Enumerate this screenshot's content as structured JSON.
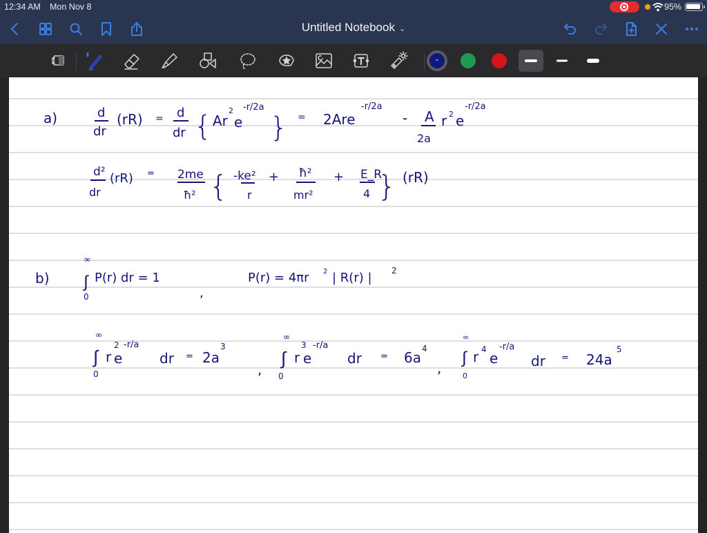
{
  "status_bar": {
    "time": "12:34 AM",
    "date": "Mon Nov 8",
    "battery_percent_label": "95%",
    "battery_level": 0.95,
    "screen_recording": true
  },
  "nav_bar": {
    "title": "Untitled Notebook",
    "left_buttons": [
      "back-icon",
      "grid-icon",
      "search-icon",
      "bookmark-icon",
      "share-icon"
    ],
    "right_buttons": [
      "undo-icon",
      "redo-icon",
      "add-page-icon",
      "close-icon",
      "more-icon"
    ]
  },
  "toolbar": {
    "tools": [
      "read-mode-icon",
      "pen-icon",
      "eraser-icon",
      "highlighter-icon",
      "shapes-icon",
      "lasso-icon",
      "sticker-icon",
      "image-icon",
      "text-icon",
      "laser-pointer-icon"
    ],
    "active_tool": "pen",
    "colors": [
      {
        "name": "navy",
        "hex": "#0e1a7a",
        "selected": true
      },
      {
        "name": "green",
        "hex": "#1f9a52",
        "selected": false
      },
      {
        "name": "red",
        "hex": "#d6121a",
        "selected": false
      }
    ],
    "stroke_sizes": [
      "fine",
      "medium",
      "thick"
    ],
    "selected_size": "fine"
  },
  "notes": {
    "ink_color": "#14147a",
    "part_a": {
      "label": "a)",
      "line1": {
        "lhs_num": "d",
        "lhs_den": "dr",
        "lhs_arg": "(rR)",
        "eq1": "=",
        "mid_num": "d",
        "mid_den": "dr",
        "mid_body": "Ar",
        "mid_sq": "2",
        "mid_e": "e",
        "mid_exp": "-r/2a",
        "eq2": "=",
        "t1": "2Are",
        "t1_exp": "-r/2a",
        "minus": "-",
        "t2_num": "A",
        "t2_den": "2a",
        "t2_body": "r",
        "t2_sq": "2",
        "t2_e": "e",
        "t2_exp": "-r/2a"
      },
      "line2": {
        "lhs_num": "d²",
        "lhs_den": "dr",
        "lhs_arg": "(rR)",
        "eq": "=",
        "c_num": "2me",
        "c_den": "ħ²",
        "f1_num": "-ke²",
        "f1_den": "r",
        "plus1": "+",
        "f2_num": "ħ²",
        "f2_den": "mr²",
        "plus2": "+",
        "f3_num": "E_R",
        "f3_den": "4",
        "tail": "(rR)"
      }
    },
    "part_b": {
      "label": "b)",
      "line1": {
        "int_upper": "∞",
        "int_lower": "0",
        "integrand": "P(r) dr = 1",
        "comma": ",",
        "p_def": "P(r) = 4πr",
        "p_sq": "2",
        "p_rest": "| R(r) |",
        "p_rest_sq": "2"
      },
      "line2": {
        "i1": {
          "upper": "∞",
          "lower": "0",
          "r": "r",
          "pow": "2",
          "e": "e",
          "exp": "-r/a",
          "dr": "dr",
          "eq": "=",
          "result": "2a",
          "result_pow": "3"
        },
        "i2": {
          "upper": "∞",
          "lower": "0",
          "r": "r",
          "pow": "3",
          "e": "e",
          "exp": "-r/a",
          "dr": "dr",
          "eq": "=",
          "result": "6a",
          "result_pow": "4"
        },
        "i3": {
          "upper": "∞",
          "lower": "0",
          "r": "r",
          "pow": "4",
          "e": "e",
          "exp": "-r/a",
          "dr": "dr",
          "eq": "=",
          "result": "24a",
          "result_pow": "5"
        },
        "comma": ","
      }
    }
  }
}
